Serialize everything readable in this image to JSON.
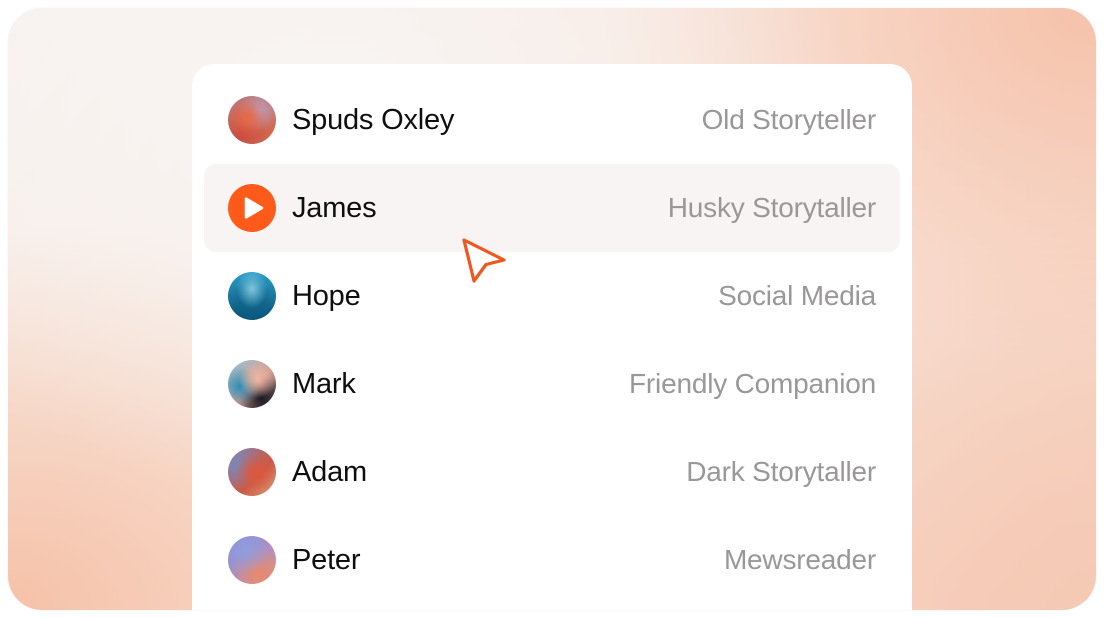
{
  "voices": [
    {
      "name": "Spuds Oxley",
      "description": "Old Storyteller",
      "avatar": "gradient-avatar-orange"
    },
    {
      "name": "James",
      "description": "Husky Storytaller",
      "avatar": "play-icon",
      "state": "hovered"
    },
    {
      "name": "Hope",
      "description": "Social Media",
      "avatar": "gradient-avatar-blue"
    },
    {
      "name": "Mark",
      "description": "Friendly Companion",
      "avatar": "gradient-avatar-multicolor"
    },
    {
      "name": "Adam",
      "description": "Dark Storytaller",
      "avatar": "gradient-avatar-red"
    },
    {
      "name": "Peter",
      "description": "Mewsreader",
      "avatar": "gradient-avatar-purple"
    }
  ],
  "colors": {
    "accent": "#ff5a1a",
    "name_text": "#0e0e0e",
    "description_text": "#9a9897",
    "hover_row": "#f7f4f3"
  },
  "icons": {
    "play": "play-icon",
    "cursor": "mouse-pointer-icon"
  }
}
